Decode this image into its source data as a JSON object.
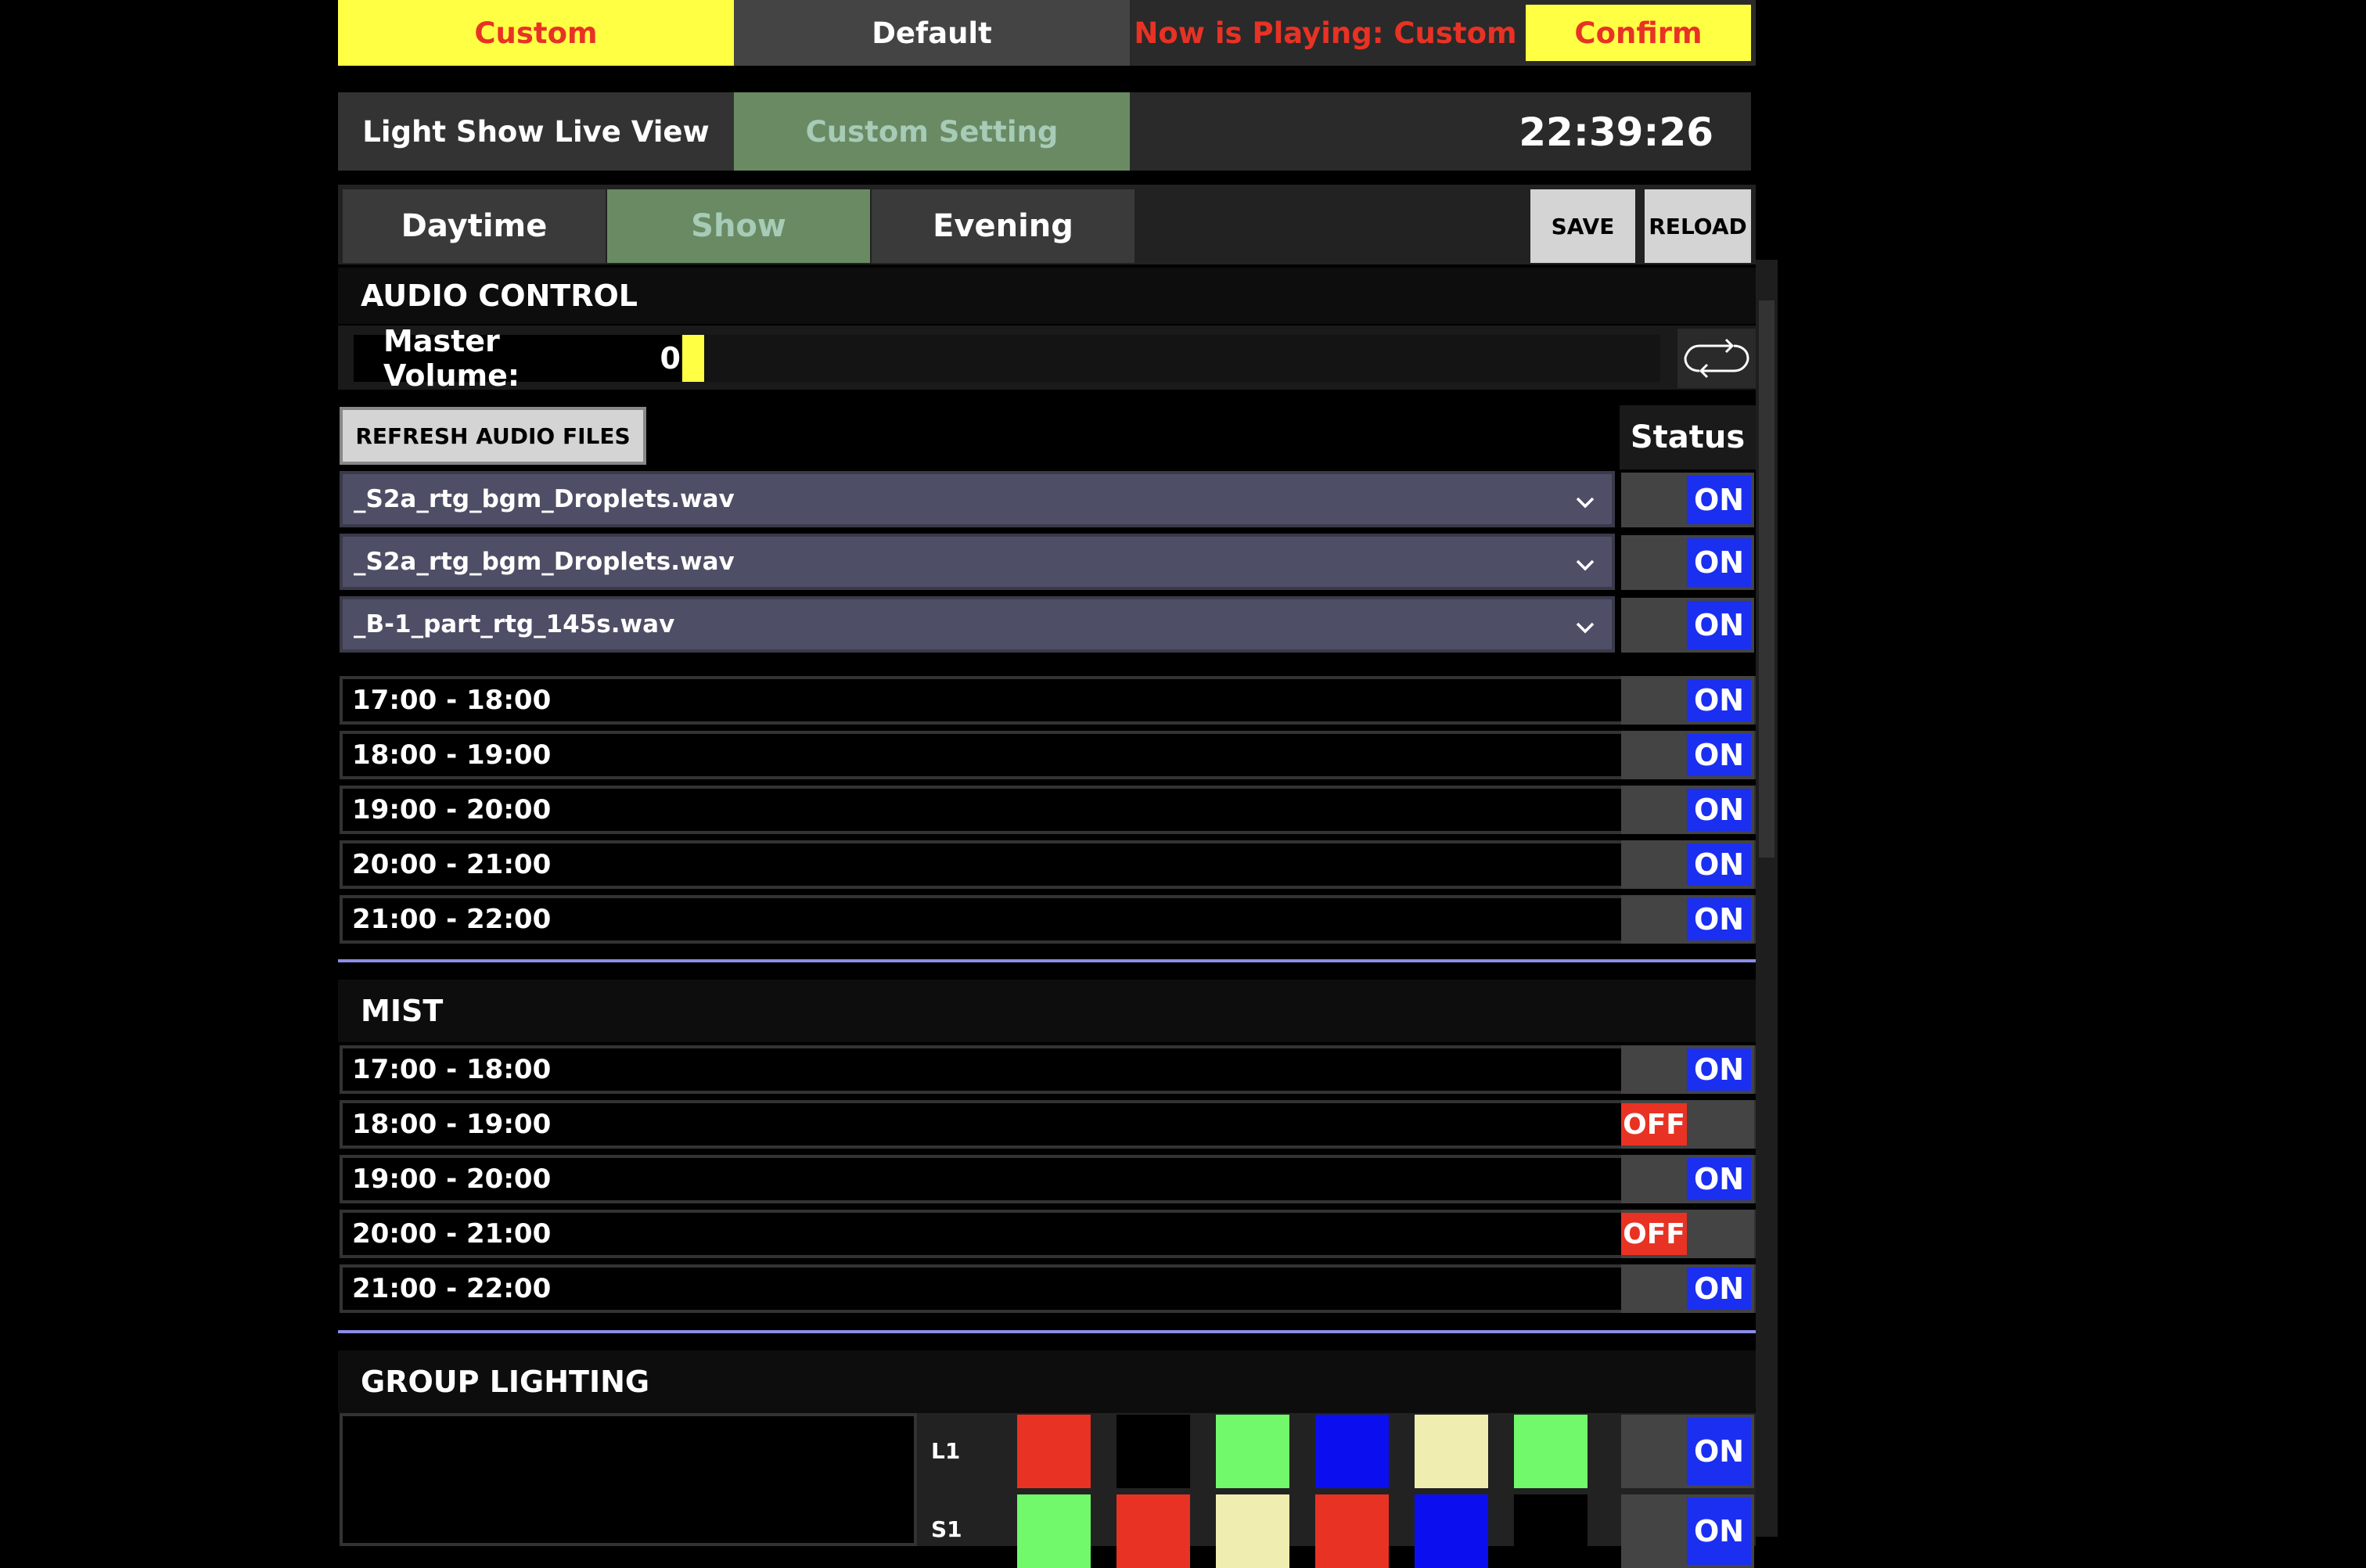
{
  "topbar": {
    "custom": "Custom",
    "default": "Default",
    "now_playing": "Now is Playing: Custom",
    "confirm": "Confirm"
  },
  "nav": {
    "live_view": "Light Show Live View",
    "custom_setting": "Custom Setting",
    "clock": "22:39:26"
  },
  "tabs": {
    "daytime": "Daytime",
    "show": "Show",
    "evening": "Evening",
    "save": "SAVE",
    "reload": "RELOAD"
  },
  "audio": {
    "title": "AUDIO CONTROL",
    "master_label": "Master Volume:",
    "master_value": "0",
    "refresh": "REFRESH AUDIO FILES",
    "status_header": "Status",
    "files": [
      "_S2a_rtg_bgm_Droplets.wav",
      "_S2a_rtg_bgm_Droplets.wav",
      "_B-1_part_rtg_145s.wav"
    ],
    "file_status": [
      "ON",
      "ON",
      "ON"
    ],
    "slots": [
      "17:00 - 18:00",
      "18:00 - 19:00",
      "19:00 - 20:00",
      "20:00 - 21:00",
      "21:00 - 22:00"
    ],
    "slot_status": [
      "ON",
      "ON",
      "ON",
      "ON",
      "ON"
    ]
  },
  "mist": {
    "title": "MIST",
    "slots": [
      "17:00 - 18:00",
      "18:00 - 19:00",
      "19:00 - 20:00",
      "20:00 - 21:00",
      "21:00 - 22:00"
    ],
    "slot_status": [
      "ON",
      "OFF",
      "ON",
      "OFF",
      "ON"
    ]
  },
  "group_lighting": {
    "title": "GROUP LIGHTING",
    "rows": [
      {
        "label": "L1",
        "colors": [
          "#e83224",
          "#000000",
          "#72f96b",
          "#0b0ff0",
          "#f0edb0",
          "#72f96b"
        ],
        "status": "ON"
      },
      {
        "label": "S1",
        "colors": [
          "#72f96b",
          "#e83224",
          "#f0edb0",
          "#e83224",
          "#0b0ff0",
          "#000000"
        ],
        "status": "ON"
      }
    ]
  },
  "colors": {
    "accent_yellow": "#ffff44",
    "accent_red": "#e83224",
    "on_blue": "#1b2ff0",
    "active_green": "#6a8a64"
  }
}
